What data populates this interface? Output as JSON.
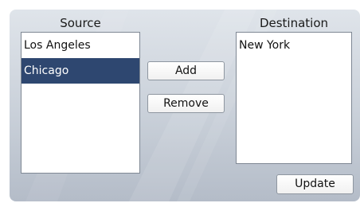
{
  "source": {
    "label": "Source",
    "items": [
      {
        "label": "Los Angeles",
        "selected": false
      },
      {
        "label": "Chicago",
        "selected": true
      }
    ]
  },
  "destination": {
    "label": "Destination",
    "items": [
      {
        "label": "New York",
        "selected": false
      }
    ]
  },
  "buttons": {
    "add_label": "Add",
    "remove_label": "Remove",
    "update_label": "Update"
  },
  "colors": {
    "selection": "#2e4770",
    "panel_top": "#dfe4ea",
    "panel_bottom": "#b4bcc8"
  }
}
